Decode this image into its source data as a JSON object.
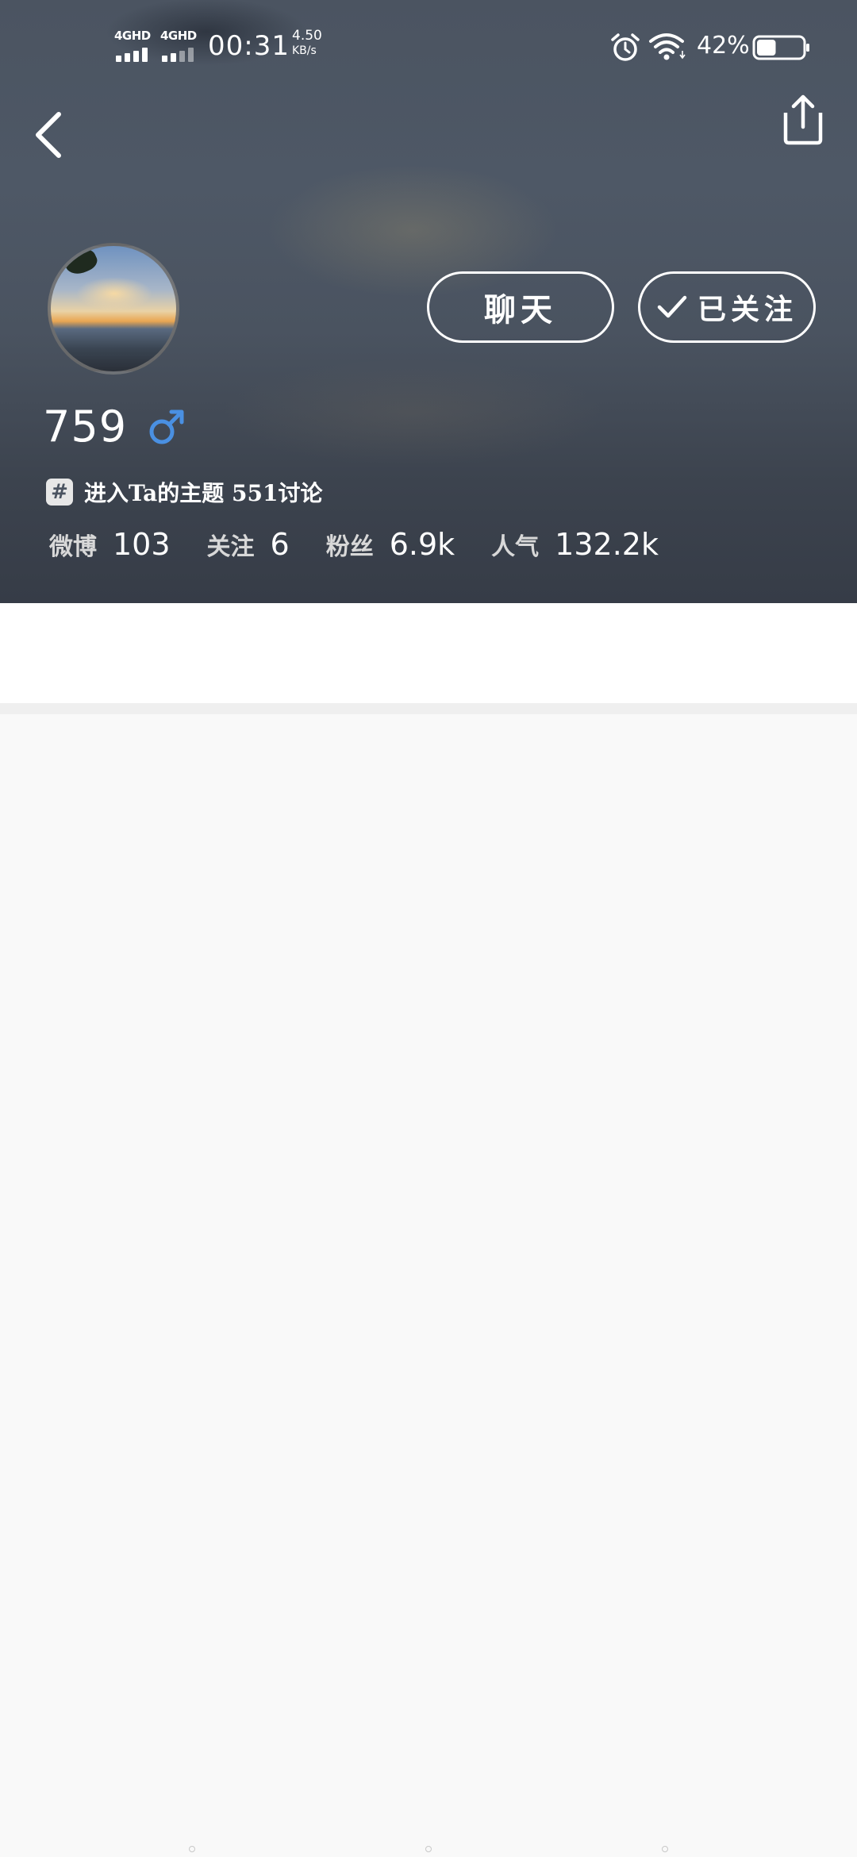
{
  "status_bar": {
    "network_1": "4GHD",
    "network_2": "4GHD",
    "time": "00:31",
    "speed_value": "4.50",
    "speed_unit": "KB/s",
    "battery_percent": "42%",
    "battery_level": 0.42,
    "icons": [
      "signal-icon",
      "signal-icon",
      "alarm-icon",
      "wifi-icon",
      "battery-icon"
    ]
  },
  "nav": {
    "back_icon": "chevron-left-icon",
    "share_icon": "share-icon"
  },
  "profile": {
    "username": "759",
    "gender_symbol": "♂",
    "gender_color": "#4a90e2",
    "chat_label": "聊天",
    "follow_label": "已关注",
    "topic_icon": "#",
    "topic_text": "进入Ta的主题 551讨论",
    "stats": [
      {
        "label": "微博",
        "value": "103"
      },
      {
        "label": "关注",
        "value": "6"
      },
      {
        "label": "粉丝",
        "value": "6.9k"
      },
      {
        "label": "人气",
        "value": "132.2k"
      }
    ]
  }
}
